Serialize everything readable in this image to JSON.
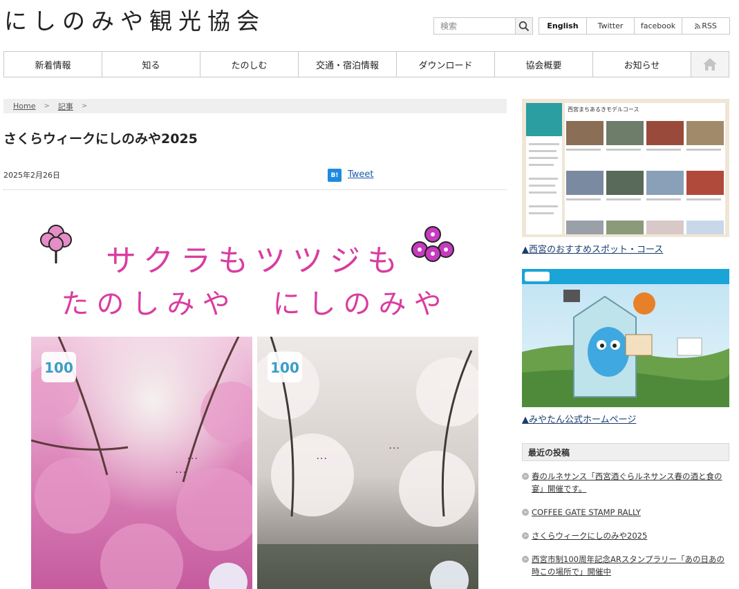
{
  "site": {
    "title": "にしのみや観光協会"
  },
  "search": {
    "placeholder": "検索"
  },
  "toplinks": [
    {
      "label": "English"
    },
    {
      "label": "Twitter"
    },
    {
      "label": "facebook"
    },
    {
      "label": "RSS"
    }
  ],
  "nav": {
    "items": [
      "新着情報",
      "知る",
      "たのしむ",
      "交通・宿泊情報",
      "ダウンロード",
      "協会概要",
      "お知らせ"
    ]
  },
  "breadcrumb": {
    "home": "Home",
    "section": "記事"
  },
  "post": {
    "title": "さくらウィークにしのみや2025",
    "date": "2025年2月26日",
    "hatena_label": "B!",
    "tweet_label": "Tweet",
    "hero_line1": "サクラもツツジも",
    "hero_line2": "たのしみや　にしのみや",
    "poster_badge": "100"
  },
  "sidebar": {
    "spot_thumbnail_title": "西宮まちあるきモデルコース",
    "spot_link": "▲西宮のおすすめスポット・コース",
    "mascot_link": "▲みやたん公式ホームページ",
    "recent_heading": "最近の投稿",
    "recent_posts": [
      "春のルネサンス「西宮酒ぐらルネサンス春の酒と食の宴」開催です。",
      "COFFEE GATE STAMP RALLY",
      "さくらウィークにしのみや2025",
      "西宮市制100周年記念ARスタンプラリー「あの日あの時この場所で」開催中"
    ]
  },
  "colors": {
    "accent_pink": "#d93da0",
    "link_blue": "#1a5ba8",
    "nav_border": "#c8c8c8"
  }
}
